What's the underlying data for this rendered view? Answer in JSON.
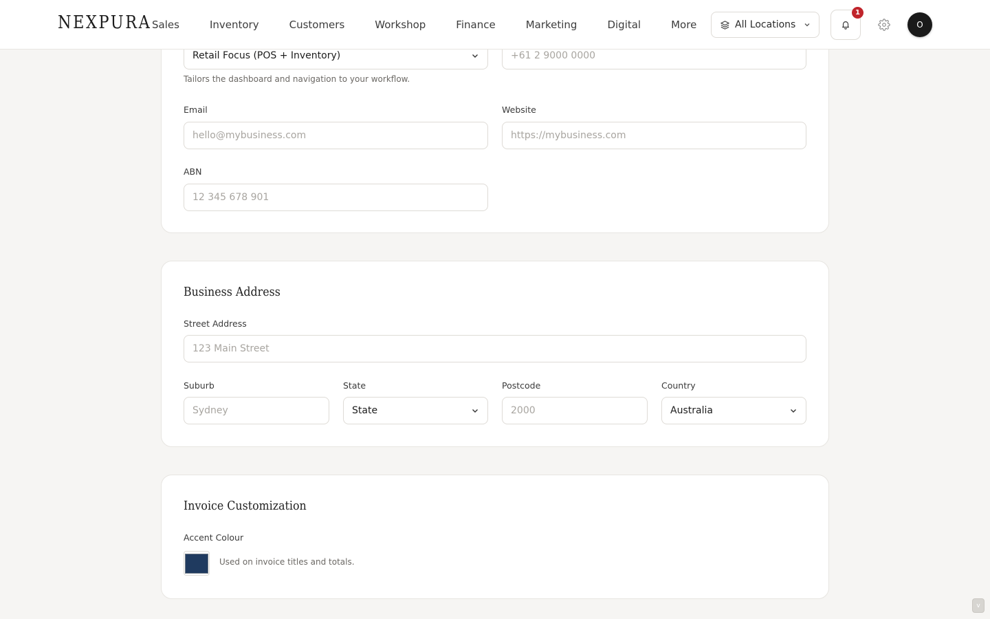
{
  "header": {
    "logo": "NEXPURA",
    "nav": [
      "Sales",
      "Inventory",
      "Customers",
      "Workshop",
      "Finance",
      "Marketing",
      "Digital",
      "More"
    ],
    "location_select": "All Locations",
    "notification_count": "1",
    "avatar_initial": "O"
  },
  "business_details": {
    "business_type_value": "Retail Focus (POS + Inventory)",
    "business_type_hint": "Tailors the dashboard and navigation to your workflow.",
    "phone_placeholder": "+61 2 9000 0000",
    "email_label": "Email",
    "email_placeholder": "hello@mybusiness.com",
    "website_label": "Website",
    "website_placeholder": "https://mybusiness.com",
    "abn_label": "ABN",
    "abn_placeholder": "12 345 678 901"
  },
  "business_address": {
    "title": "Business Address",
    "street_label": "Street Address",
    "street_placeholder": "123 Main Street",
    "suburb_label": "Suburb",
    "suburb_placeholder": "Sydney",
    "state_label": "State",
    "state_value": "State",
    "postcode_label": "Postcode",
    "postcode_placeholder": "2000",
    "country_label": "Country",
    "country_value": "Australia"
  },
  "invoice_customization": {
    "title": "Invoice Customization",
    "accent_label": "Accent Colour",
    "accent_color": "#1f3a5f",
    "accent_hint": "Used on invoice titles and totals."
  },
  "scroll_button_label": "v"
}
